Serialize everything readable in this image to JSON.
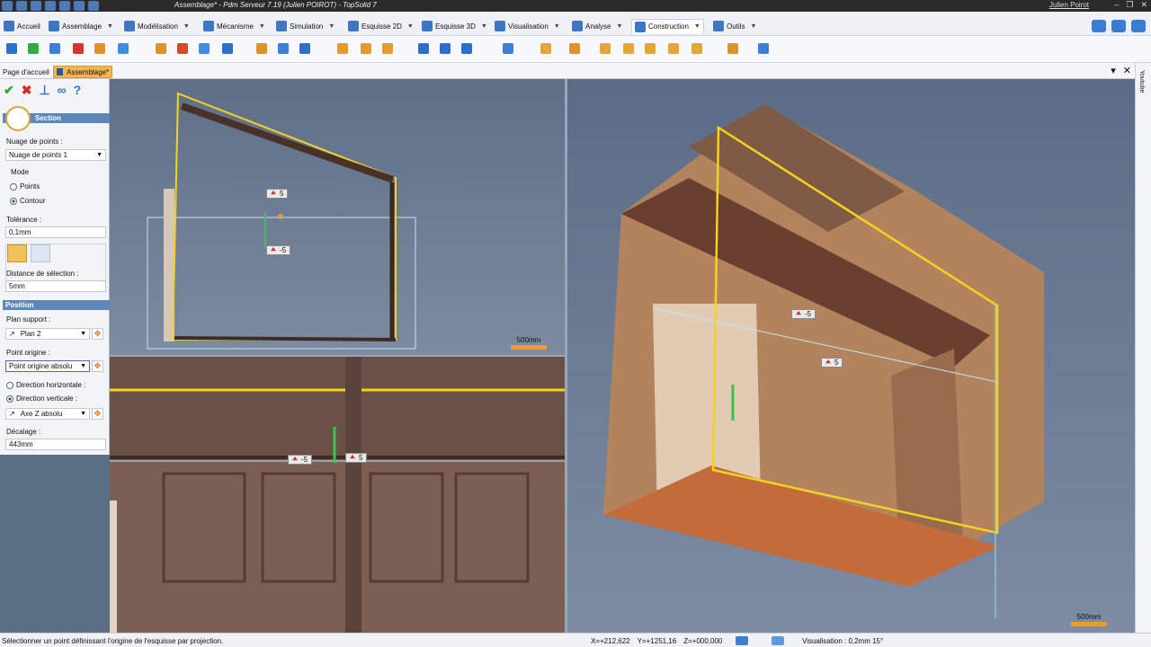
{
  "window": {
    "title": "Assemblage* - Pdm Serveur 7.19 (Julien POIROT) - TopSolid 7",
    "user": "Julien Poirot",
    "controls": [
      "–",
      "❐",
      "✕"
    ]
  },
  "menu_tabs": [
    {
      "label": "Accueil"
    },
    {
      "label": "Assemblage"
    },
    {
      "label": "Modélisation"
    },
    {
      "label": "Mécanisme"
    },
    {
      "label": "Simulation"
    },
    {
      "label": "Esquisse 2D"
    },
    {
      "label": "Esquisse 3D"
    },
    {
      "label": "Visualisation"
    },
    {
      "label": "Analyse"
    },
    {
      "label": "Construction"
    },
    {
      "label": "Outils"
    }
  ],
  "doc_tabs": {
    "home": "Page d'accueil",
    "active": "Assemblage*"
  },
  "right_sidebar": {
    "label": "Youtube"
  },
  "panel": {
    "title": "Section",
    "point_cloud_label": "Nuage de points :",
    "point_cloud_value": "Nuage de points 1",
    "mode_label": "Mode",
    "mode_points": "Points",
    "mode_contour": "Contour",
    "tolerance_label": "Tolérance :",
    "tolerance_value": "0,1mm",
    "selection_distance_label": "Distance de sélection :",
    "selection_distance_value": "5mm",
    "position_title": "Position",
    "support_plane_label": "Plan support :",
    "support_plane_value": "Plan 2",
    "origin_point_label": "Point origine :",
    "origin_point_value": "Point origine absolu",
    "dir_horizontal": "Direction horizontale :",
    "dir_vertical": "Direction verticale :",
    "axis_value": "Axe Z absolu",
    "offset_label": "Décalage :",
    "offset_value": "443mm"
  },
  "viewport": {
    "scale_label_tl": "500mm",
    "scale_label_r": "500mm",
    "badges_tl": [
      "5",
      "-5"
    ],
    "badges_bl": [
      "-5",
      "5"
    ],
    "badges_r": [
      "-5",
      "5"
    ]
  },
  "status": {
    "message": "Sélectionner un point définissant l'origine de l'esquisse par projection.",
    "x": "X=+212,622",
    "y": "Y=+1251,16",
    "z": "Z=+000,000",
    "visualisation": "Visualisation : 0,2mm 15°"
  },
  "colors": {
    "title_bar": "#2a2a2a",
    "panel_header": "#5b87bb",
    "section_outline": "#f5d21c",
    "scale_bar": "#f29b2b",
    "active_tab": "#f4b64e"
  }
}
